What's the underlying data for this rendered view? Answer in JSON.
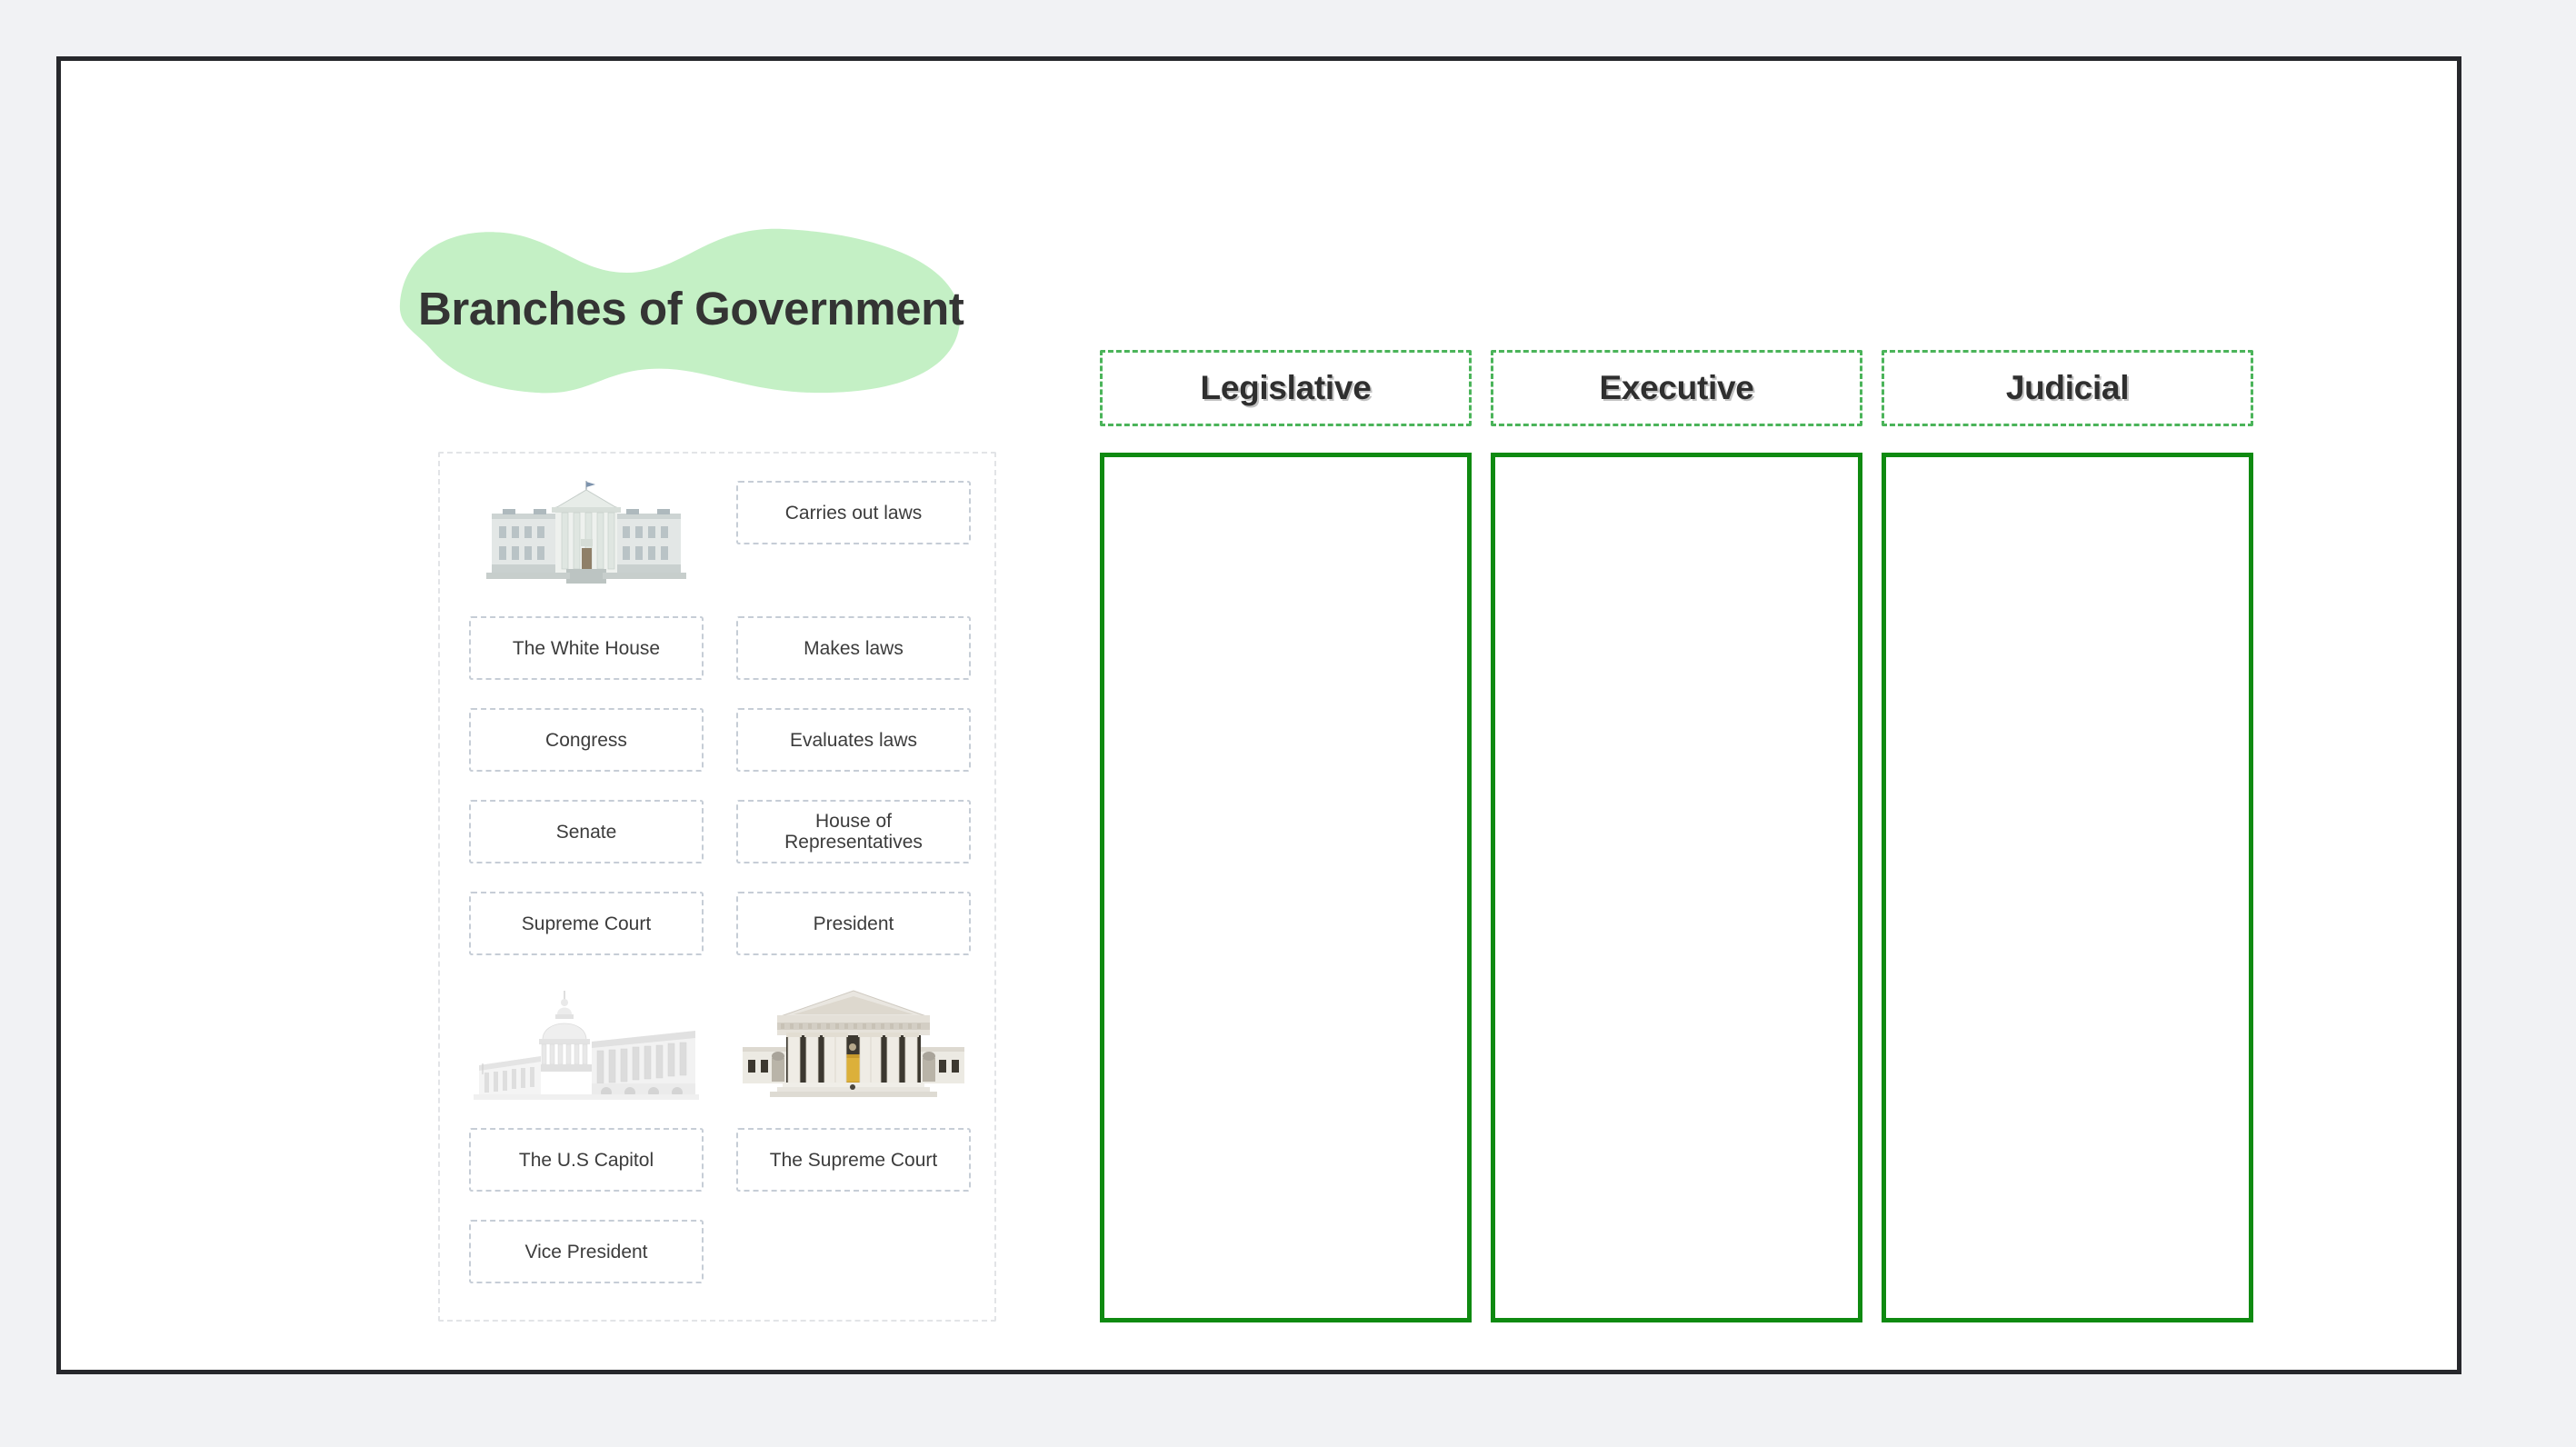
{
  "worksheet": {
    "title": "Branches of Government",
    "title_blob_color": "#c4f0c5",
    "page_border_color": "#27282c",
    "background_color": "#f1f2f4"
  },
  "word_bank": {
    "container_border_color": "#e2e4e7",
    "tile_border_color": "#c6cdd6",
    "items": [
      {
        "id": "white-house-image",
        "type": "image",
        "label": "The White House building photograph",
        "icon": "white-house-image"
      },
      {
        "id": "carries-out-laws",
        "type": "text",
        "label": "Carries out laws"
      },
      {
        "id": "the-white-house",
        "type": "text",
        "label": "The White House"
      },
      {
        "id": "makes-laws",
        "type": "text",
        "label": "Makes laws"
      },
      {
        "id": "congress",
        "type": "text",
        "label": "Congress"
      },
      {
        "id": "evaluates-laws",
        "type": "text",
        "label": "Evaluates laws"
      },
      {
        "id": "senate",
        "type": "text",
        "label": "Senate"
      },
      {
        "id": "house-of-representatives",
        "type": "text",
        "label": "House of Representatives",
        "line1": "House of",
        "line2": "Representatives"
      },
      {
        "id": "supreme-court",
        "type": "text",
        "label": "Supreme Court"
      },
      {
        "id": "president",
        "type": "text",
        "label": "President"
      },
      {
        "id": "us-capitol-image",
        "type": "image",
        "label": "The U.S Capitol building photograph",
        "icon": "us-capitol-image"
      },
      {
        "id": "supreme-court-image",
        "type": "image",
        "label": "The Supreme Court building photograph",
        "icon": "supreme-court-image"
      },
      {
        "id": "the-us-capitol",
        "type": "text",
        "label": "The U.S Capitol"
      },
      {
        "id": "the-supreme-court",
        "type": "text",
        "label": "The Supreme Court"
      },
      {
        "id": "vice-president",
        "type": "text",
        "label": "Vice President"
      }
    ]
  },
  "categories": {
    "header_border_color": "#4bb45a",
    "dropzone_border_color": "#0f8a11",
    "columns": [
      {
        "id": "legislative",
        "label": "Legislative",
        "dropped_items": []
      },
      {
        "id": "executive",
        "label": "Executive",
        "dropped_items": []
      },
      {
        "id": "judicial",
        "label": "Judicial",
        "dropped_items": []
      }
    ]
  }
}
